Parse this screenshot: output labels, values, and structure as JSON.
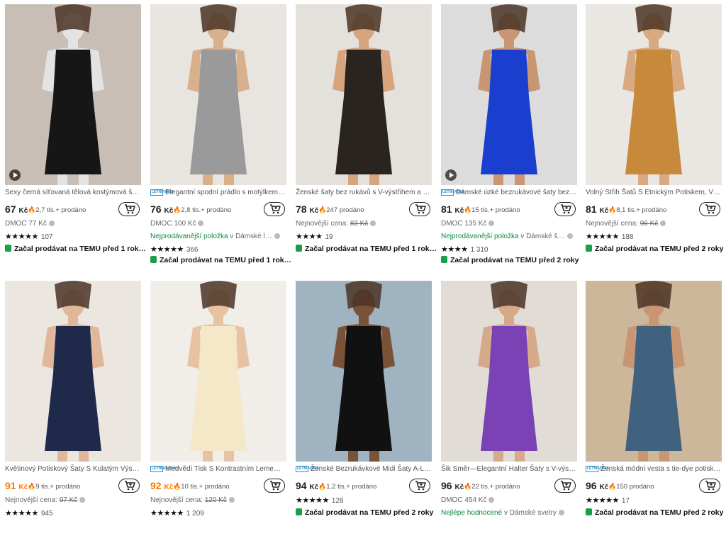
{
  "products": [
    {
      "title": "Sexy černá síťovaná tělová kostýmová šaty…",
      "tag": "",
      "price": "67",
      "currency": "Kč",
      "price_orange": false,
      "sold": "2,7 tis.+ prodáno",
      "sub_prefix": "",
      "sub_main": "DMOC 77 Kč",
      "sub_suffix": "",
      "stars": "★★★★★",
      "rating": "107",
      "seller": "Začal prodávat na TEMU před 1 rok…",
      "img": {
        "bg": "#c9beb5",
        "dress": "#161616",
        "skin": "#e3e3e3"
      },
      "play": true
    },
    {
      "title": "Elegantní spodní prádlo s motýlkem …",
      "tag": "LETNÍ VIBES",
      "price": "76",
      "currency": "Kč",
      "price_orange": false,
      "sold": "2,8 tis.+ prodáno",
      "sub_prefix": "",
      "sub_main": "DMOC 100 Kč",
      "sub_suffix": "",
      "stars": "",
      "rating": "",
      "seller": "",
      "img": {
        "bg": "#e8e4df",
        "dress": "#9a9a9a",
        "skin": "#d9b08c"
      },
      "play": false
    },
    {
      "title": "Ženské šaty bez rukávů s V-výstřihem a od…",
      "tag": "",
      "price": "78",
      "currency": "Kč",
      "price_orange": false,
      "sold": "247 prodáno",
      "sub_prefix": "Nejnovější cena: ",
      "sub_main": "83 Kč",
      "sub_suffix": "",
      "stars": "★★★★",
      "rating": "19",
      "seller": "Začal prodávat na TEMU před 1 rok…",
      "img": {
        "bg": "#e4e1dc",
        "dress": "#2a2420",
        "skin": "#d6a57e"
      },
      "play": false
    },
    {
      "title": "Dámské úzké bezrukávové šaty bez r…",
      "tag": "LETNÍ VIBES",
      "price": "81",
      "currency": "Kč",
      "price_orange": false,
      "sold": "15 tis.+ prodáno",
      "sub_prefix": "",
      "sub_main": "DMOC 135 Kč",
      "sub_suffix": "",
      "stars": "",
      "rating": "",
      "seller": "",
      "img": {
        "bg": "#dcdcdc",
        "dress": "#1a3fcf",
        "skin": "#c99674"
      },
      "play": true
    },
    {
      "title": "Volný Střih Šatů S Etnickým Potiskem, Vint…",
      "tag": "",
      "price": "81",
      "currency": "Kč",
      "price_orange": false,
      "sold": "8,1 tis.+ prodáno",
      "sub_prefix": "Nejnovější cena: ",
      "sub_main": "96 Kč",
      "sub_suffix": "",
      "stars": "★★★★★",
      "rating": "188",
      "seller": "Začal prodávat na TEMU před 2 roky",
      "img": {
        "bg": "#eae7e2",
        "dress": "#c78a3c",
        "skin": "#d9a982"
      },
      "play": false
    },
    {
      "title": "Květinový Potiskový Šaty S Kulatým Výstřih…",
      "tag": "",
      "price": "91",
      "currency": "Kč",
      "price_orange": true,
      "sold": "9 tis.+ prodáno",
      "sub_prefix": "Nejnovější cena: ",
      "sub_main": "97 Kč",
      "sub_suffix": "",
      "stars": "★★★★★",
      "rating": "945",
      "seller": "",
      "img": {
        "bg": "#ece6e1",
        "dress": "#1f2a4a",
        "skin": "#e0b798"
      },
      "play": false
    },
    {
      "title": "Medvědí Tisk S Kontrastním Lemem…",
      "tag": "LETNÍ NÁBIDKY",
      "price": "92",
      "currency": "Kč",
      "price_orange": true,
      "sold": "10 tis.+ prodáno",
      "sub_prefix": "Nejnovější cena: ",
      "sub_main": "120 Kč",
      "sub_suffix": "",
      "stars": "★★★★★",
      "rating": "1 209",
      "seller": "",
      "img": {
        "bg": "#f1eee9",
        "dress": "#f4e8c8",
        "skin": "#e8c3a3"
      },
      "play": false
    },
    {
      "title": "Ženské Bezrukávkové Midi Šaty A-Lin…",
      "tag": "LETNÍ VIBES",
      "price": "94",
      "currency": "Kč",
      "price_orange": false,
      "sold": "1,2 tis.+ prodáno",
      "sub_prefix": "",
      "sub_main": "",
      "sub_suffix": "",
      "stars": "★★★★★",
      "rating": "128",
      "seller": "Začal prodávat na TEMU před 2 roky",
      "img": {
        "bg": "#9fb3c0",
        "dress": "#111111",
        "skin": "#7a5238"
      },
      "play": false
    },
    {
      "title": "Šik Směr—Elegantní Halter Šaty s V-výstřih…",
      "tag": "",
      "price": "96",
      "currency": "Kč",
      "price_orange": false,
      "sold": "22 tis.+ prodáno",
      "sub_prefix": "",
      "sub_main": "DMOC 454 Kč",
      "sub_suffix": "",
      "stars": "",
      "rating": "",
      "seller": "",
      "img": {
        "bg": "#e2dcd6",
        "dress": "#7b42b5",
        "skin": "#d6a98a"
      },
      "play": false
    },
    {
      "title": "Ženská módní vesta s tie-dye potiskem",
      "tag": "LETNÍ VIBES",
      "price": "96",
      "currency": "Kč",
      "price_orange": false,
      "sold": "150 prodáno",
      "sub_prefix": "",
      "sub_main": "",
      "sub_suffix": "",
      "stars": "★★★★★",
      "rating": "17",
      "seller": "Začal prodávat na TEMU před 2 roky",
      "img": {
        "bg": "#cdb79b",
        "dress": "#41627e",
        "skin": "#c99674"
      },
      "play": false
    }
  ],
  "extra": {
    "p2_stars": "★★★★★",
    "p2_rating": "366",
    "p2_sub_green": "Nejprodávanější položka",
    "p2_sub_rest": " v Dámské l…",
    "p2_seller": "Začal prodávat na TEMU před 1 rok…",
    "p4_stars": "★★★★",
    "p4_rating": "1 310",
    "p4_sub_green": "Nejprodávanější položka",
    "p4_sub_rest": " v Dámské š…",
    "p4_seller": "Začal prodávat na TEMU před 2 roky",
    "p9_sub_green": "Nejlépe hodnocené",
    "p9_sub_rest": " v Dámské svetry",
    "p8_stars": "★★★★★",
    "p8_rating": "128"
  },
  "colors": {
    "accent": "#fb7701",
    "green": "#0a8a3d",
    "tag": "#2a8fd0"
  }
}
